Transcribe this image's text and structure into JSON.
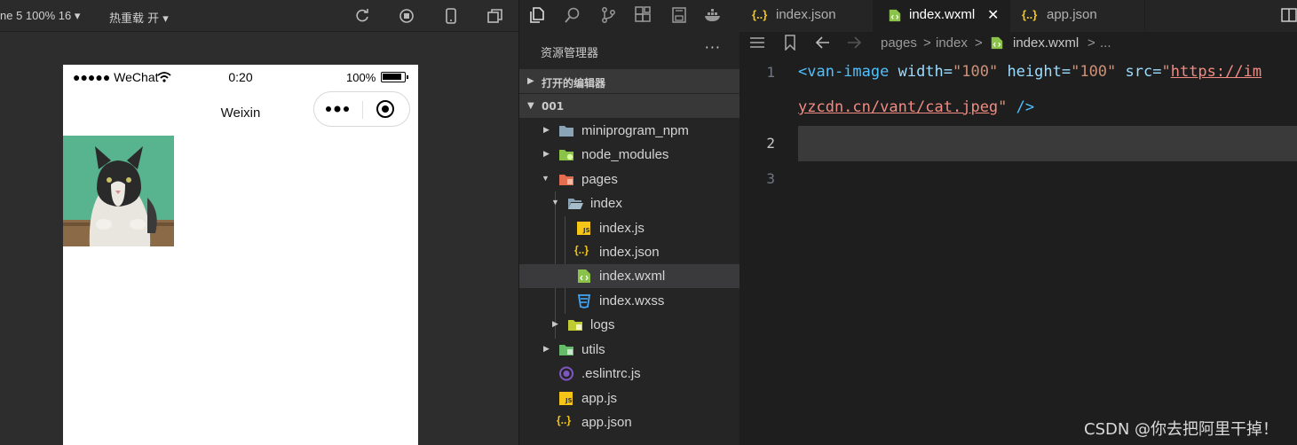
{
  "simulator": {
    "device_label": "ne 5 100% 16 ▾",
    "hot_reload_label": "热重载 开 ▾",
    "status": {
      "carrier": "●●●●● WeChat",
      "time": "0:20",
      "battery": "100%"
    },
    "nav_title": "Weixin"
  },
  "explorer": {
    "header": "资源管理器",
    "more": "···",
    "open_editors": "打开的编辑器",
    "project": "001",
    "tree": [
      {
        "name": "miniprogram_npm"
      },
      {
        "name": "node_modules"
      },
      {
        "name": "pages"
      },
      {
        "name": "index"
      },
      {
        "name": "index.js"
      },
      {
        "name": "index.json"
      },
      {
        "name": "index.wxml"
      },
      {
        "name": "index.wxss"
      },
      {
        "name": "logs"
      },
      {
        "name": "utils"
      },
      {
        "name": ".eslintrc.js"
      },
      {
        "name": "app.js"
      },
      {
        "name": "app.json"
      }
    ]
  },
  "editor": {
    "tabs": [
      {
        "icon": "{..}",
        "label": "index.json"
      },
      {
        "icon": "wxml",
        "label": "index.wxml",
        "close": "✕"
      },
      {
        "icon": "{..}",
        "label": "app.json"
      }
    ],
    "breadcrumb": [
      "pages",
      ">",
      "index",
      ">",
      "index.wxml",
      ">",
      "..."
    ],
    "line_numbers": [
      "1",
      "2",
      "3"
    ],
    "code": {
      "tag_open": "<van-image",
      "a1": " width=",
      "v1": "\"100\"",
      "a2": " height=",
      "v2": "\"100\"",
      "a3": " src=",
      "q": "\"",
      "url1": "https://im",
      "url2": "yzcdn.cn/vant/cat.jpeg",
      "end": "\"",
      "close": " />"
    },
    "watermark": "CSDN @你去把阿里干掉！"
  },
  "colors": {
    "tag": "#4fc1ff",
    "attribute": "#9cdcfe",
    "string": "#ce9178",
    "url": "#f28b82"
  }
}
